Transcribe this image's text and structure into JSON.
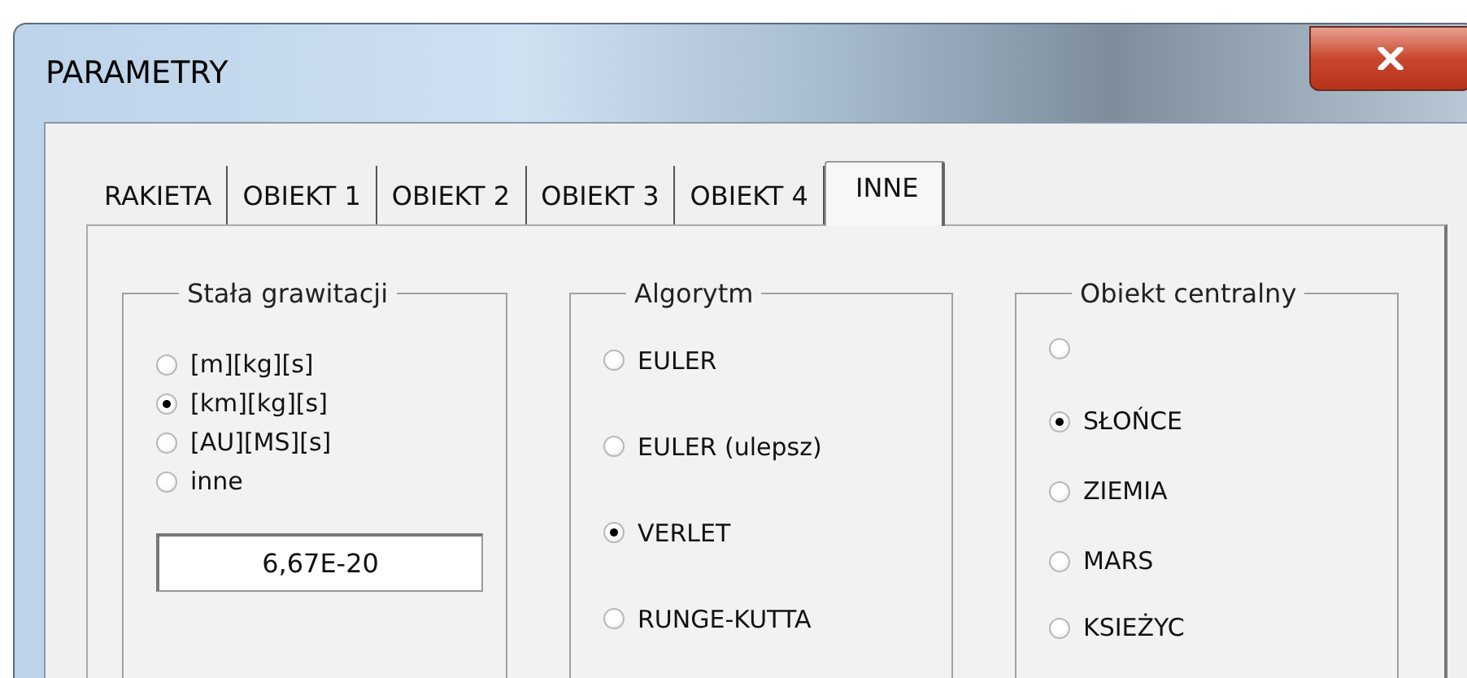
{
  "window": {
    "title": "PARAMETRY"
  },
  "tabs": [
    {
      "label": "RAKIETA",
      "selected": false
    },
    {
      "label": "OBIEKT 1",
      "selected": false
    },
    {
      "label": "OBIEKT 2",
      "selected": false
    },
    {
      "label": "OBIEKT 3",
      "selected": false
    },
    {
      "label": "OBIEKT 4",
      "selected": false
    },
    {
      "label": "INNE",
      "selected": true
    }
  ],
  "groups": [
    {
      "title": "Stała grawitacji",
      "options": [
        {
          "label": "[m][kg][s]",
          "selected": false
        },
        {
          "label": "[km][kg][s]",
          "selected": true
        },
        {
          "label": "[AU][MS][s]",
          "selected": false
        },
        {
          "label": "inne",
          "selected": false
        }
      ],
      "field": {
        "value": "6,67E-20"
      }
    },
    {
      "title": "Algorytm",
      "options": [
        {
          "label": "EULER",
          "selected": false
        },
        {
          "label": "EULER (ulepsz)",
          "selected": false
        },
        {
          "label": "VERLET",
          "selected": true
        },
        {
          "label": "RUNGE-KUTTA",
          "selected": false
        }
      ]
    },
    {
      "title": "Obiekt centralny",
      "options": [
        {
          "selected": false
        },
        {
          "label": "SŁOŃCE",
          "selected": true
        },
        {
          "label": "ZIEMIA",
          "selected": false
        },
        {
          "label": "MARS",
          "selected": false
        },
        {
          "label": "KSIEŻYC",
          "selected": false
        }
      ]
    }
  ]
}
